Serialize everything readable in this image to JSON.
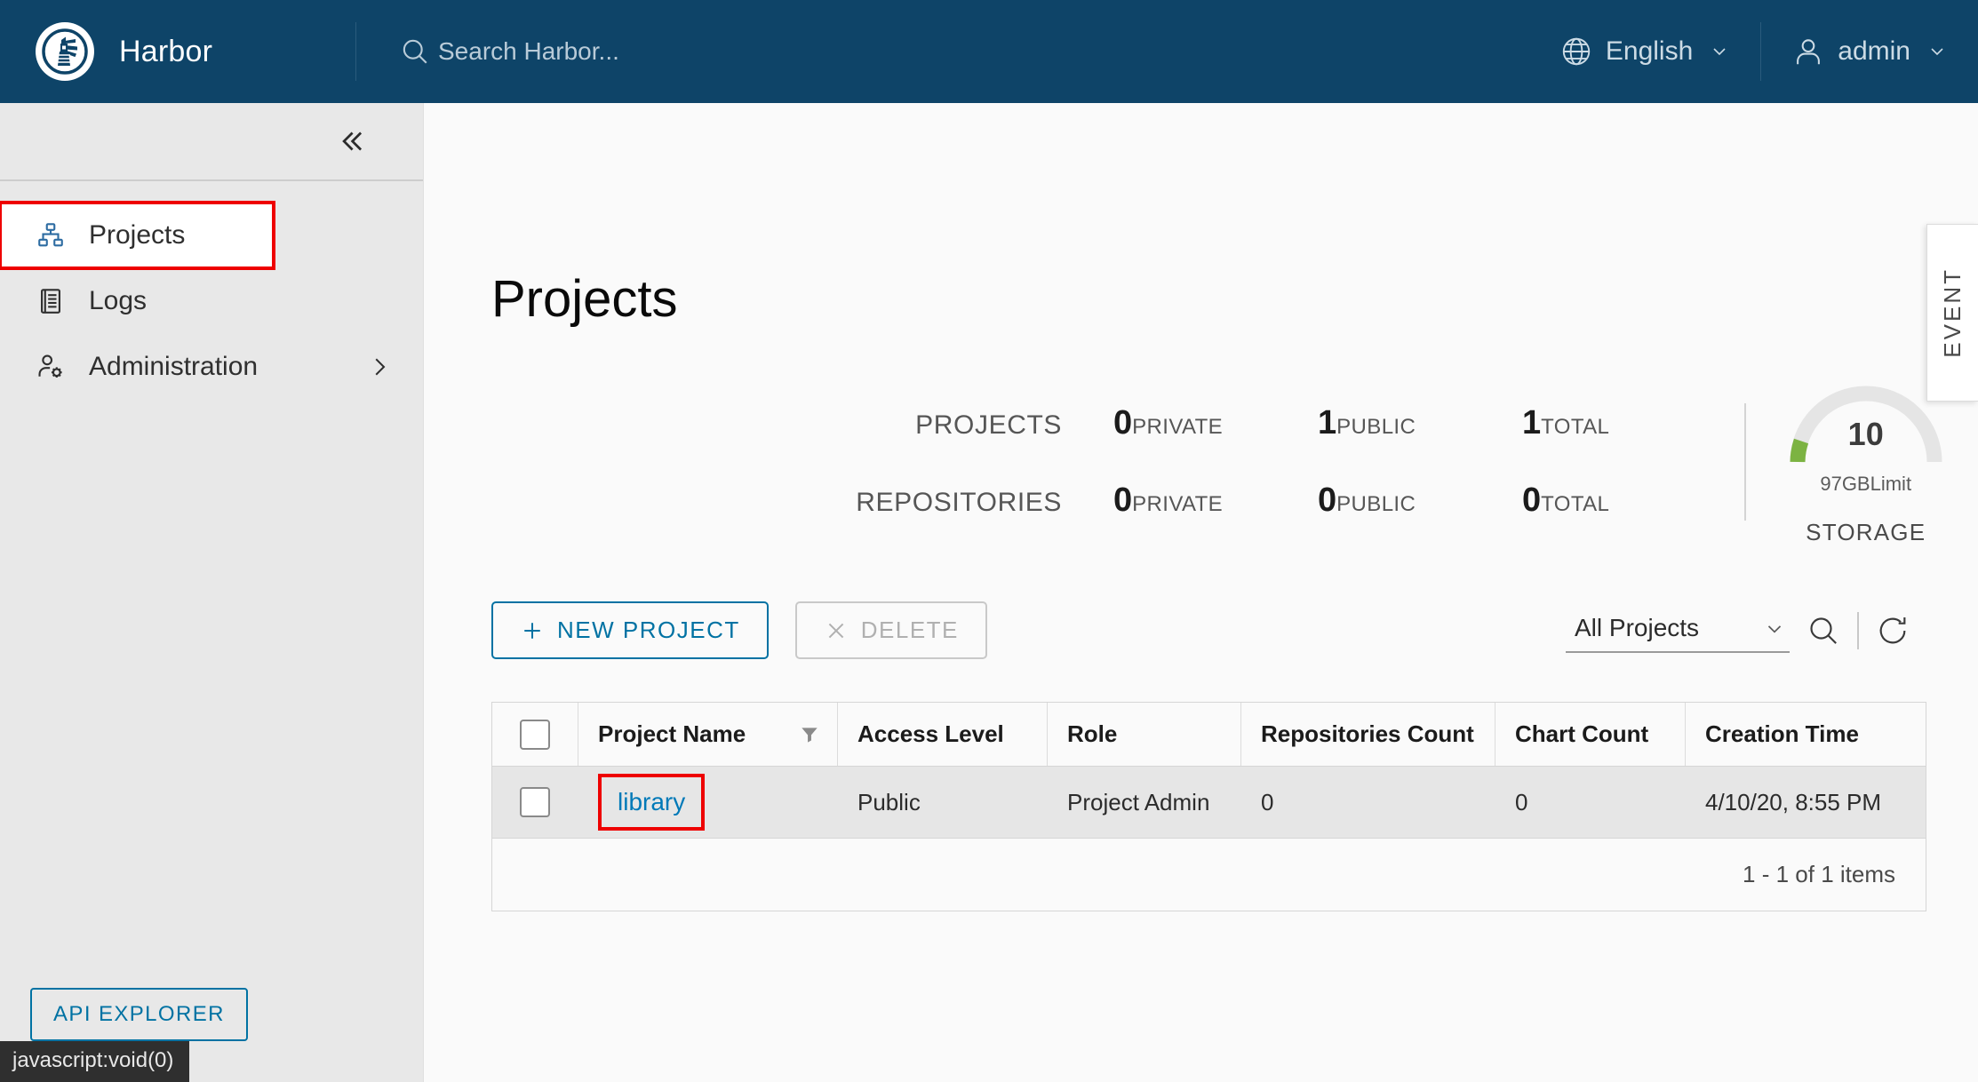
{
  "header": {
    "brand_title": "Harbor",
    "logo_icon": "harbor-lighthouse-logo",
    "search": {
      "icon": "search-icon",
      "placeholder": "Search Harbor...",
      "value": ""
    },
    "language": {
      "icon": "globe-icon",
      "label": "English",
      "caret": "chevron-down-icon"
    },
    "user": {
      "icon": "user-icon",
      "label": "admin",
      "caret": "chevron-down-icon"
    }
  },
  "sidebar": {
    "collapse_icon": "double-chevron-left-icon",
    "items": [
      {
        "label": "Projects",
        "icon": "projects-hierarchy-icon",
        "active": true,
        "expand": ""
      },
      {
        "label": "Logs",
        "icon": "logs-document-icon",
        "active": false,
        "expand": ""
      },
      {
        "label": "Administration",
        "icon": "user-gear-icon",
        "active": false,
        "expand": "chevron-right-icon"
      }
    ],
    "api_explorer_label": "API EXPLORER"
  },
  "main": {
    "page_title": "Projects",
    "statistics": {
      "rows": [
        {
          "label": "PROJECTS",
          "cells": [
            {
              "value": "0",
              "unit": "PRIVATE"
            },
            {
              "value": "1",
              "unit": "PUBLIC"
            },
            {
              "value": "1",
              "unit": "TOTAL"
            }
          ]
        },
        {
          "label": "REPOSITORIES",
          "cells": [
            {
              "value": "0",
              "unit": "PRIVATE"
            },
            {
              "value": "0",
              "unit": "PUBLIC"
            },
            {
              "value": "0",
              "unit": "TOTAL"
            }
          ]
        }
      ],
      "storage": {
        "value": "10",
        "limit": "97GBLimit",
        "caption": "STORAGE",
        "arc_color": "#7cb342",
        "track_color": "#e5e5e5",
        "percent": 10
      }
    },
    "toolbar": {
      "new_project_label": "NEW PROJECT",
      "new_project_icon": "plus-icon",
      "delete_label": "DELETE",
      "delete_icon": "close-x-icon",
      "filter_label": "All Projects",
      "filter_caret": "chevron-down-icon",
      "search_icon": "search-icon",
      "refresh_icon": "refresh-icon"
    },
    "table": {
      "columns": [
        {
          "label": "",
          "name": "select-all-checkbox"
        },
        {
          "label": "Project Name",
          "name": "project-name",
          "filter_icon": "filter-funnel-icon"
        },
        {
          "label": "Access Level",
          "name": "access-level"
        },
        {
          "label": "Role",
          "name": "role"
        },
        {
          "label": "Repositories Count",
          "name": "repositories-count"
        },
        {
          "label": "Chart Count",
          "name": "chart-count"
        },
        {
          "label": "Creation Time",
          "name": "creation-time"
        }
      ],
      "rows": [
        {
          "project_name": "library",
          "access_level": "Public",
          "role": "Project Admin",
          "repositories_count": "0",
          "chart_count": "0",
          "creation_time": "4/10/20, 8:55 PM",
          "highlighted": true
        }
      ],
      "pagination": "1 - 1 of 1 items"
    }
  },
  "event_tab": {
    "label": "EVENT"
  },
  "status_bar": {
    "text": "javascript:void(0)"
  },
  "colors": {
    "header_bg": "#0e4468",
    "accent_link": "#0079b8",
    "accent_button": "#0072a3",
    "highlight_box": "#ee0000",
    "gauge_green": "#7cb342"
  }
}
